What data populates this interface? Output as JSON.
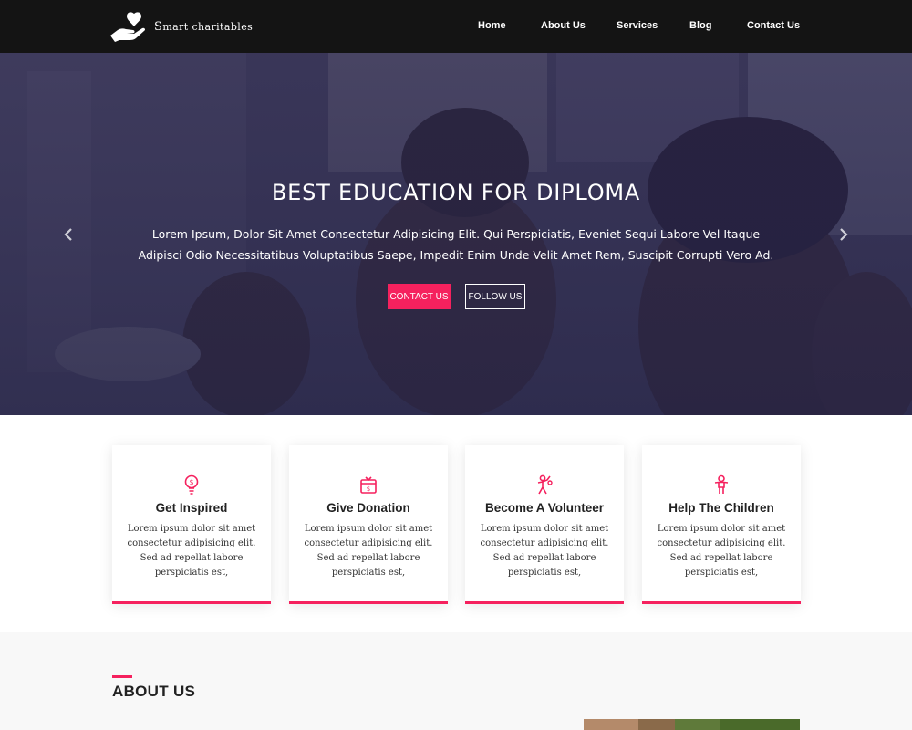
{
  "brand": {
    "name_first_letter": "S",
    "name_rest": "mart charitables",
    "logo_icon": "heart-hand-icon"
  },
  "nav": {
    "items": [
      {
        "label": "Home"
      },
      {
        "label": "About Us"
      },
      {
        "label": "Services"
      },
      {
        "label": "Blog"
      },
      {
        "label": "Contact Us"
      }
    ]
  },
  "hero": {
    "title": "BEST EDUCATION FOR DIPLOMA",
    "description": "Lorem Ipsum, Dolor Sit Amet Consectetur Adipisicing Elit. Qui Perspiciatis, Eveniet Sequi Labore Vel Itaque Adipisci Odio Necessitatibus Voluptatibus Saepe, Impedit Enim Unde Velit Amet Rem, Suscipit Corrupti Vero Ad.",
    "contact_button": "CONTACT US",
    "follow_button": "FOLLOW US",
    "prev_icon": "chevron-left-icon",
    "next_icon": "chevron-right-icon",
    "overlay_color": "#2b2850"
  },
  "features": {
    "cards": [
      {
        "title": "Get Inspired",
        "text": "Lorem ipsum dolor sit amet consectetur adipisicing elit. Sed ad repellat labore perspiciatis est,",
        "icon": "lightbulb-dollar-icon"
      },
      {
        "title": "Give Donation",
        "text": "Lorem ipsum dolor sit amet consectetur adipisicing elit. Sed ad repellat labore perspiciatis est,",
        "icon": "donation-box-icon"
      },
      {
        "title": "Become A Volunteer",
        "text": "Lorem ipsum dolor sit amet consectetur adipisicing elit. Sed ad repellat labore perspiciatis est,",
        "icon": "volunteer-icon"
      },
      {
        "title": "Help The Children",
        "text": "Lorem ipsum dolor sit amet consectetur adipisicing elit. Sed ad repellat labore perspiciatis est,",
        "icon": "child-icon"
      }
    ]
  },
  "about": {
    "title": "ABOUT US"
  },
  "colors": {
    "accent": "#f5215e",
    "header_bg": "#141414"
  }
}
